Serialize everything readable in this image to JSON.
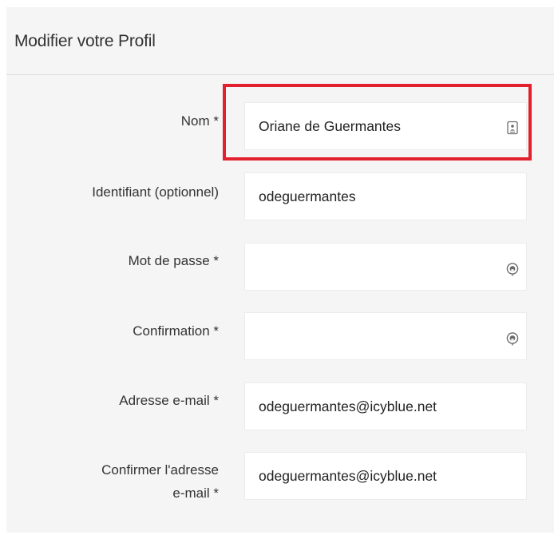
{
  "panel": {
    "title": "Modifier votre Profil"
  },
  "form": {
    "name": {
      "label": "Nom *",
      "value": "Oriane de Guermantes",
      "icon": "contact-card-icon"
    },
    "username": {
      "label": "Identifiant (optionnel)",
      "value": "odeguermantes"
    },
    "password": {
      "label": "Mot de passe *",
      "value": "",
      "icon": "password-key-icon"
    },
    "password_confirm": {
      "label": "Confirmation *",
      "value": "",
      "icon": "password-key-icon"
    },
    "email": {
      "label": "Adresse e-mail *",
      "value": "odeguermantes@icyblue.net"
    },
    "email_confirm": {
      "label_line1": "Confirmer l'adresse",
      "label_line2": "e-mail *",
      "value": "odeguermantes@icyblue.net"
    }
  },
  "colors": {
    "panel_background": "#f5f5f5",
    "highlight_border": "#e3202e",
    "text": "#333333"
  }
}
